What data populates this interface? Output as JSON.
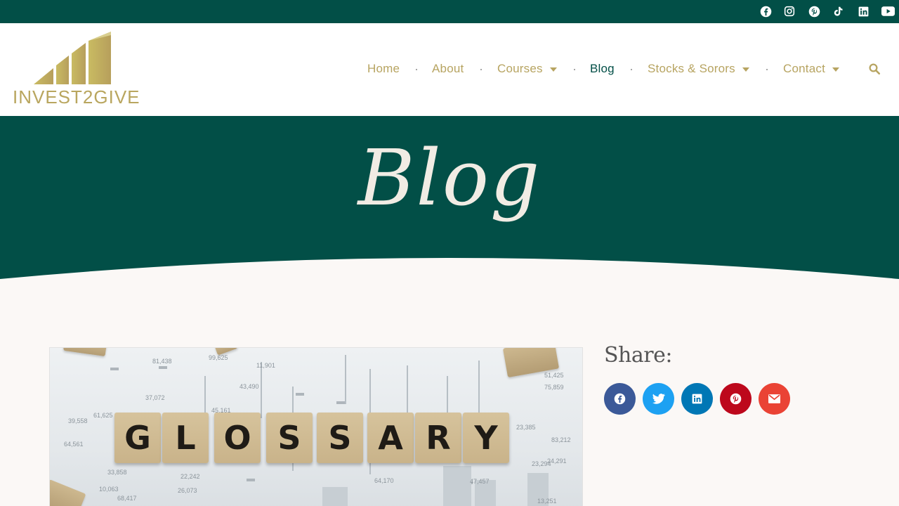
{
  "topbar": {
    "social": [
      {
        "name": "facebook-icon"
      },
      {
        "name": "instagram-icon"
      },
      {
        "name": "pinterest-icon"
      },
      {
        "name": "tiktok-icon"
      },
      {
        "name": "linkedin-icon"
      },
      {
        "name": "youtube-icon"
      }
    ]
  },
  "logo": {
    "text": "INVEST2GIVE"
  },
  "nav": {
    "items": [
      {
        "label": "Home",
        "dropdown": false
      },
      {
        "label": "About",
        "dropdown": false
      },
      {
        "label": "Courses",
        "dropdown": true
      },
      {
        "label": "Blog",
        "dropdown": false,
        "active": true
      },
      {
        "label": "Stocks & Sorors",
        "dropdown": true
      },
      {
        "label": "Contact",
        "dropdown": true
      }
    ],
    "search_icon": "search-icon"
  },
  "hero": {
    "title": "Blog"
  },
  "featured_image": {
    "letters": [
      "G",
      "L",
      "O",
      "S",
      "S",
      "A",
      "R",
      "Y"
    ],
    "numbers": [
      "81,438",
      "99,625",
      "11,901",
      "37,072",
      "45,161",
      "43,490",
      "39,558",
      "64,561",
      "61,625",
      "51,425",
      "75,859",
      "83,212",
      "23,294",
      "24,291",
      "22,242",
      "47,457",
      "64,170",
      "26,073",
      "68,417",
      "10,063",
      "33,858",
      "23,385",
      "13,251"
    ]
  },
  "share": {
    "title": "Share:",
    "buttons": [
      {
        "name": "share-facebook-button",
        "icon": "facebook-icon",
        "color": "#3b5998"
      },
      {
        "name": "share-twitter-button",
        "icon": "twitter-icon",
        "color": "#1da1f2"
      },
      {
        "name": "share-linkedin-button",
        "icon": "linkedin-icon",
        "color": "#0077b5"
      },
      {
        "name": "share-pinterest-button",
        "icon": "pinterest-icon",
        "color": "#bd081c"
      },
      {
        "name": "share-email-button",
        "icon": "email-icon",
        "color": "#ea4335"
      }
    ]
  },
  "colors": {
    "brand_green": "#024f47",
    "gold": "#b7a461",
    "background": "#fbf8f6"
  }
}
